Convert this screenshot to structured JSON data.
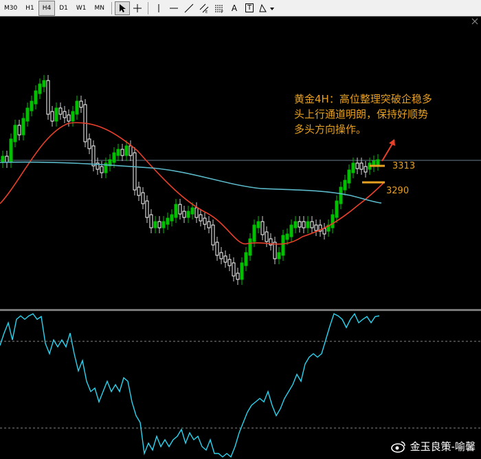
{
  "toolbar": {
    "timeframes": [
      "M30",
      "H1",
      "H4",
      "D1",
      "W1",
      "MN"
    ],
    "active_timeframe": "H4",
    "tools": [
      "cursor-icon",
      "crosshair-icon",
      "vertical-line-icon",
      "horizontal-line-icon",
      "trendline-icon",
      "channel-icon",
      "fibonacci-icon",
      "text-icon",
      "label-icon",
      "shapes-icon"
    ],
    "text_tool": "A",
    "label_tool": "T"
  },
  "annotation": {
    "line1": "黄金4H：高位整理突破企稳多",
    "line2": "头上行通道明朗，保持好顺势",
    "line3": "多头方向操作。"
  },
  "levels": {
    "upper": "3313",
    "lower": "3290"
  },
  "watermark": "金玉良策-喻馨",
  "colors": {
    "bull": "#00c000",
    "bear": "#ffffff",
    "ma_fast": "#e8402a",
    "ma_slow": "#5ab8c8",
    "indicator": "#2ad4f0",
    "annotation": "#e8a020",
    "arrow": "#e8402a"
  }
}
